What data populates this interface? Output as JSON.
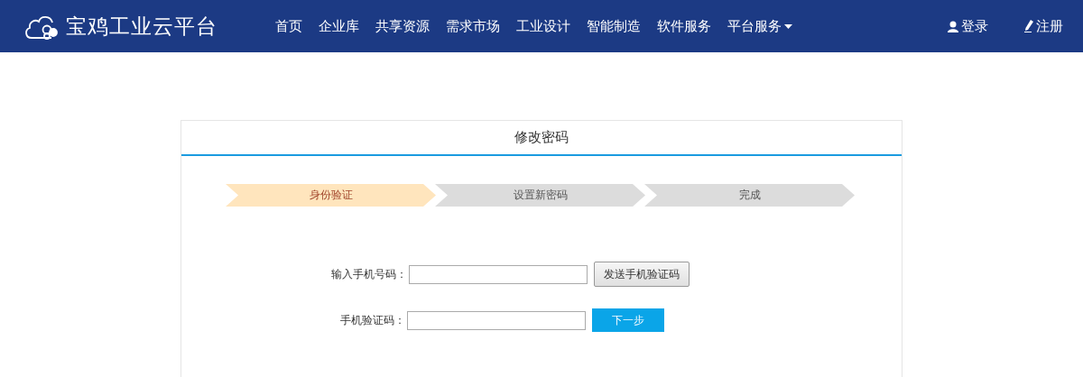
{
  "brand": {
    "name": "宝鸡工业云平台"
  },
  "nav": [
    {
      "label": "首页",
      "dropdown": false
    },
    {
      "label": "企业库",
      "dropdown": false
    },
    {
      "label": "共享资源",
      "dropdown": false
    },
    {
      "label": "需求市场",
      "dropdown": false
    },
    {
      "label": "工业设计",
      "dropdown": false
    },
    {
      "label": "智能制造",
      "dropdown": false
    },
    {
      "label": "软件服务",
      "dropdown": false
    },
    {
      "label": "平台服务",
      "dropdown": true
    }
  ],
  "account": [
    {
      "kind": "login",
      "label": "登录"
    },
    {
      "kind": "register",
      "label": "注册"
    }
  ],
  "card": {
    "title": "修改密码"
  },
  "steps": [
    {
      "label": "身份验证",
      "selected": true
    },
    {
      "label": "设置新密码",
      "selected": false
    },
    {
      "label": "完成",
      "selected": false
    }
  ],
  "form": [
    {
      "label": "输入手机号码：",
      "button": "发送手机验证码",
      "kind": "secondary"
    },
    {
      "label": "手机验证码：",
      "button": "下一步",
      "kind": "primary"
    }
  ]
}
